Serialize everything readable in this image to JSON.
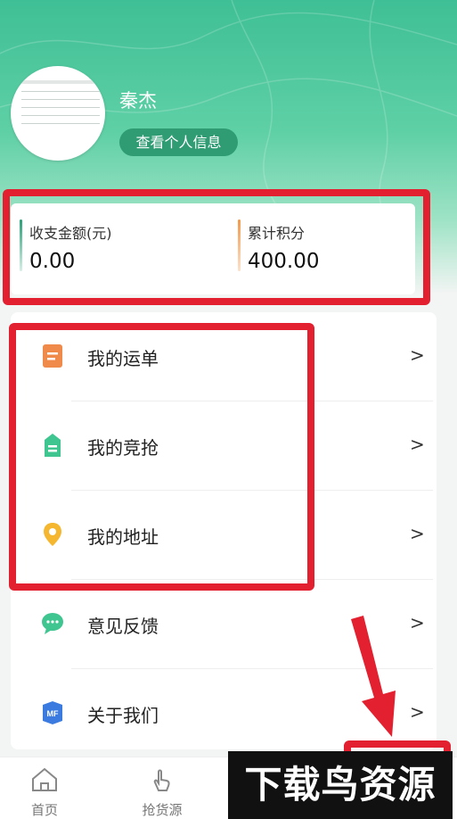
{
  "profile": {
    "name": "秦杰",
    "view_info_label": "查看个人信息"
  },
  "stats": {
    "income_label": "收支金额(元)",
    "income_value": "0.00",
    "points_label": "累计积分",
    "points_value": "400.00"
  },
  "menu": {
    "items": [
      {
        "label": "我的运单",
        "icon": "document-icon",
        "chevron": ">"
      },
      {
        "label": "我的竞抢",
        "icon": "bid-icon",
        "chevron": ">"
      },
      {
        "label": "我的地址",
        "icon": "location-icon",
        "chevron": ">"
      },
      {
        "label": "意见反馈",
        "icon": "chat-icon",
        "chevron": ">"
      },
      {
        "label": "关于我们",
        "icon": "mf-logo-icon",
        "chevron": ">"
      }
    ]
  },
  "tabbar": {
    "home_label": "首页",
    "grab_label": "抢货源"
  },
  "watermark": {
    "text": "下载鸟资源"
  },
  "colors": {
    "brand_green": "#2f9c74",
    "highlight_red": "#e2202f",
    "points_orange": "#f2994a"
  }
}
